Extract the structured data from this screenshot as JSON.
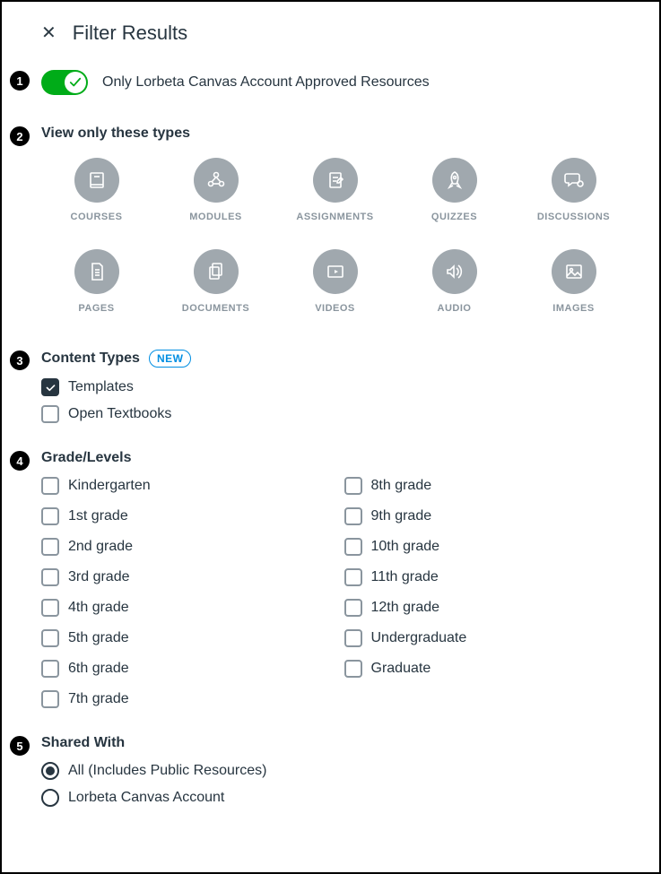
{
  "header": {
    "title": "Filter Results"
  },
  "annotations": [
    "1",
    "2",
    "3",
    "4",
    "5"
  ],
  "approved": {
    "label": "Only Lorbeta Canvas Account Approved Resources",
    "on": true
  },
  "types": {
    "header": "View only these types",
    "items": [
      {
        "label": "COURSES",
        "icon": "book"
      },
      {
        "label": "MODULES",
        "icon": "modules"
      },
      {
        "label": "ASSIGNMENTS",
        "icon": "assignment"
      },
      {
        "label": "QUIZZES",
        "icon": "rocket"
      },
      {
        "label": "DISCUSSIONS",
        "icon": "discussion"
      },
      {
        "label": "PAGES",
        "icon": "page"
      },
      {
        "label": "DOCUMENTS",
        "icon": "documents"
      },
      {
        "label": "VIDEOS",
        "icon": "video"
      },
      {
        "label": "AUDIO",
        "icon": "audio"
      },
      {
        "label": "IMAGES",
        "icon": "image"
      }
    ]
  },
  "content_types": {
    "header": "Content Types",
    "badge": "NEW",
    "options": [
      {
        "label": "Templates",
        "checked": true
      },
      {
        "label": "Open Textbooks",
        "checked": false
      }
    ]
  },
  "grades": {
    "header": "Grade/Levels",
    "col1": [
      "Kindergarten",
      "1st grade",
      "2nd grade",
      "3rd grade",
      "4th grade",
      "5th grade",
      "6th grade",
      "7th grade"
    ],
    "col2": [
      "8th grade",
      "9th grade",
      "10th grade",
      "11th grade",
      "12th grade",
      "Undergraduate",
      "Graduate"
    ]
  },
  "shared": {
    "header": "Shared With",
    "options": [
      {
        "label": "All (Includes Public Resources)",
        "selected": true
      },
      {
        "label": "Lorbeta Canvas Account",
        "selected": false
      }
    ]
  }
}
